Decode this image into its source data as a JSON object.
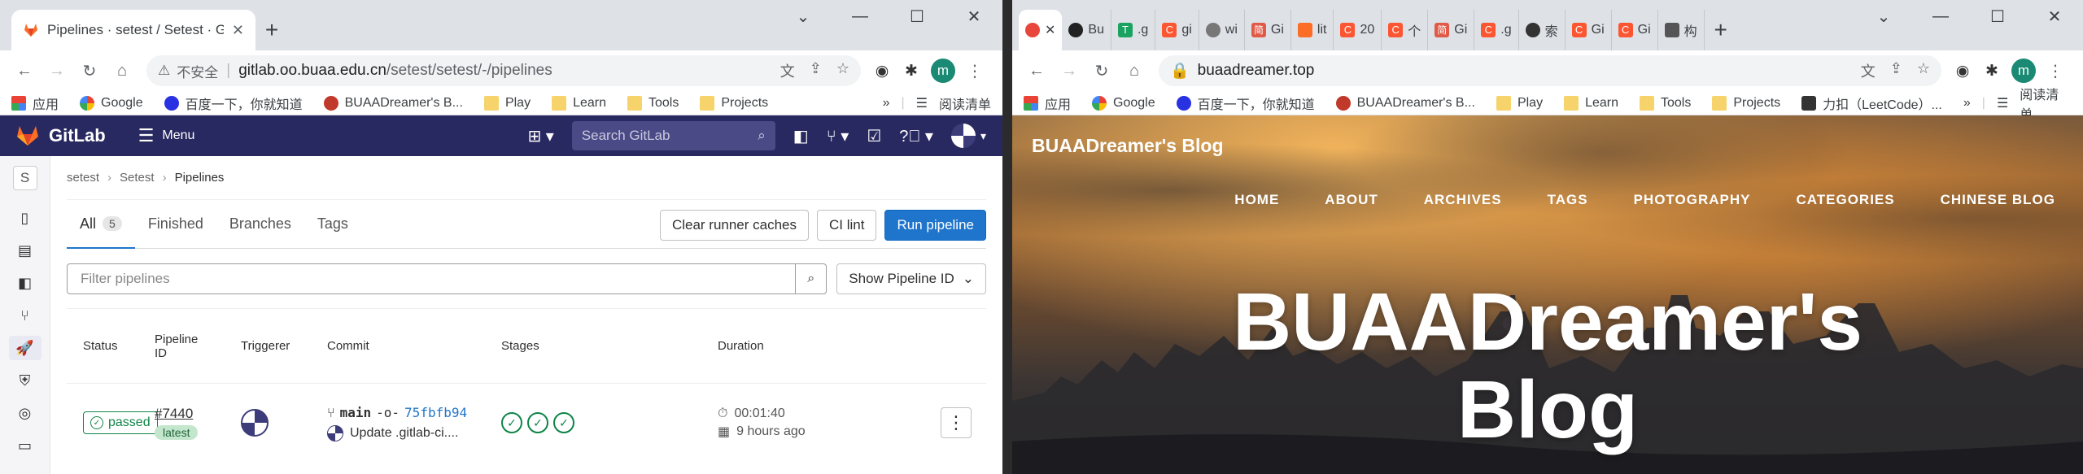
{
  "left": {
    "tab": {
      "title": "Pipelines · setest / Setest · Git",
      "close": "✕"
    },
    "new_tab": "+",
    "window_controls": [
      "⌄",
      "—",
      "☐",
      "✕"
    ],
    "toolbar": {
      "back": "←",
      "forward": "→",
      "reload": "↻",
      "home": "⌂",
      "insecure_label": "不安全",
      "url_host": "gitlab.oo.buaa.edu.cn",
      "url_path": "/setest/setest/-/pipelines",
      "avatar_letter": "m",
      "menu": "⋮"
    },
    "bookmarks": [
      {
        "label": "应用",
        "kind": "apps"
      },
      {
        "label": "Google",
        "kind": "google"
      },
      {
        "label": "百度一下，你就知道",
        "kind": "baidu"
      },
      {
        "label": "BUAADreamer's B...",
        "kind": "blog"
      },
      {
        "label": "Play",
        "kind": "folder"
      },
      {
        "label": "Learn",
        "kind": "folder"
      },
      {
        "label": "Tools",
        "kind": "folder"
      },
      {
        "label": "Projects",
        "kind": "folder"
      }
    ],
    "bookmarks_more": "»",
    "reading_list": "阅读清单",
    "gitlab": {
      "brand": "GitLab",
      "menu": "Menu",
      "search_placeholder": "Search GitLab",
      "project_letter": "S",
      "breadcrumbs": [
        "setest",
        "Setest",
        "Pipelines"
      ],
      "tabs": [
        {
          "label": "All",
          "count": "5"
        },
        {
          "label": "Finished"
        },
        {
          "label": "Branches"
        },
        {
          "label": "Tags"
        }
      ],
      "buttons": {
        "clear_cache": "Clear runner caches",
        "ci_lint": "CI lint",
        "run_pipeline": "Run pipeline"
      },
      "filter_placeholder": "Filter pipelines",
      "sort_label": "Show Pipeline ID",
      "columns": {
        "status": "Status",
        "pipeline_id_1": "Pipeline",
        "pipeline_id_2": "ID",
        "triggerer": "Triggerer",
        "commit": "Commit",
        "stages": "Stages",
        "duration": "Duration"
      },
      "rows": [
        {
          "status": "passed",
          "id": "#7440",
          "tag": "latest",
          "branch": "main",
          "sha": "75fbfb94",
          "message": "Update .gitlab-ci....",
          "stages": [
            "✓",
            "✓",
            "✓"
          ],
          "duration": "00:01:40",
          "finished": "9 hours ago"
        }
      ]
    }
  },
  "right": {
    "tabs": [
      {
        "label": "",
        "color": "#e8453c",
        "active": true,
        "close": "✕"
      },
      {
        "label": "Bu",
        "color": "#222222"
      },
      {
        "label": ".g",
        "color": "#1aa260",
        "glyph": "T"
      },
      {
        "label": "gi",
        "color": "#fc5531",
        "glyph": "C"
      },
      {
        "label": "wi",
        "color": "#777777"
      },
      {
        "label": "Gi",
        "color": "#e05a47",
        "glyph": "简"
      },
      {
        "label": "lit",
        "color": "#fc6d26"
      },
      {
        "label": "20",
        "color": "#fc5531",
        "glyph": "C"
      },
      {
        "label": "个",
        "color": "#fc5531",
        "glyph": "C"
      },
      {
        "label": "Gi",
        "color": "#e05a47",
        "glyph": "简"
      },
      {
        "label": ".g",
        "color": "#fc5531",
        "glyph": "C"
      },
      {
        "label": "索",
        "color": "#333333"
      },
      {
        "label": "Gi",
        "color": "#fc5531",
        "glyph": "C"
      },
      {
        "label": "Gi",
        "color": "#fc5531",
        "glyph": "C"
      },
      {
        "label": "构",
        "color": "#555555"
      }
    ],
    "new_tab": "+",
    "window_controls": [
      "⌄",
      "—",
      "☐",
      "✕"
    ],
    "toolbar": {
      "back": "←",
      "forward": "→",
      "reload": "↻",
      "home": "⌂",
      "url": "buaadreamer.top",
      "avatar_letter": "m",
      "menu": "⋮"
    },
    "bookmarks": [
      {
        "label": "应用",
        "kind": "apps"
      },
      {
        "label": "Google",
        "kind": "google"
      },
      {
        "label": "百度一下，你就知道",
        "kind": "baidu"
      },
      {
        "label": "BUAADreamer's B...",
        "kind": "blog"
      },
      {
        "label": "Play",
        "kind": "folder"
      },
      {
        "label": "Learn",
        "kind": "folder"
      },
      {
        "label": "Tools",
        "kind": "folder"
      },
      {
        "label": "Projects",
        "kind": "folder"
      },
      {
        "label": "力扣（LeetCode）...",
        "kind": "leetcode"
      }
    ],
    "bookmarks_more": "»",
    "reading_list": "阅读清单",
    "blog": {
      "brand": "BUAADreamer's Blog",
      "nav": [
        "HOME",
        "ABOUT",
        "ARCHIVES",
        "TAGS",
        "PHOTOGRAPHY",
        "CATEGORIES",
        "CHINESE BLOG"
      ],
      "hero_line1": "BUAADreamer's",
      "hero_line2": "Blog"
    }
  },
  "colors": {
    "gitlab_nav": "#292961",
    "primary_blue": "#1f75cb",
    "success_green": "#108548",
    "chrome_tabstrip": "#dee1e6"
  }
}
